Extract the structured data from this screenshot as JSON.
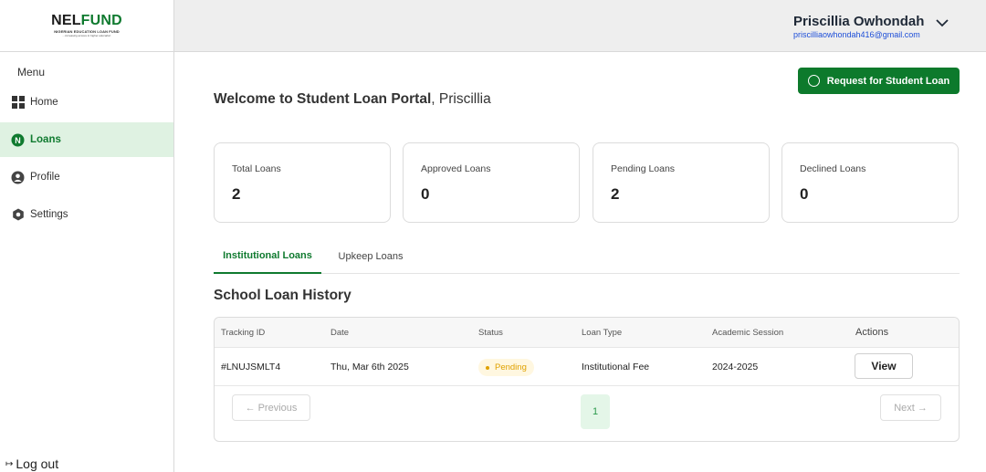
{
  "brand": {
    "logo_nel": "NEL",
    "logo_fund": "FUND",
    "logo_subtitle": "NIGERIAN EDUCATION LOAN FUND",
    "logo_tagline": "...increasing access to higher education",
    "accent_color": "#0d7a2c"
  },
  "sidebar": {
    "menu_label": "Menu",
    "items": [
      {
        "label": "Home",
        "icon": "grid-icon",
        "active": false
      },
      {
        "label": "Loans",
        "icon": "nelfund-n-icon",
        "active": true
      },
      {
        "label": "Profile",
        "icon": "user-icon",
        "active": false
      },
      {
        "label": "Settings",
        "icon": "hexagon-settings-icon",
        "active": false
      }
    ],
    "logout_label": "Log out"
  },
  "header": {
    "user_name": "Priscillia Owhondah",
    "user_email": "priscilliaowhondah416@gmail.com"
  },
  "main": {
    "request_button": "Request for Student Loan",
    "welcome_strong": "Welcome to Student Loan Portal",
    "welcome_name": ", Priscillia",
    "stats": [
      {
        "label": "Total Loans",
        "value": "2"
      },
      {
        "label": "Approved Loans",
        "value": "0"
      },
      {
        "label": "Pending Loans",
        "value": "2"
      },
      {
        "label": "Declined Loans",
        "value": "0"
      }
    ],
    "tabs": [
      {
        "label": "Institutional Loans",
        "active": true
      },
      {
        "label": "Upkeep Loans",
        "active": false
      }
    ],
    "history_title": "School Loan History",
    "table": {
      "headers": [
        "Tracking ID",
        "Date",
        "Status",
        "Loan Type",
        "Academic Session",
        "Actions"
      ],
      "rows": [
        {
          "tracking_id": "#LNUJSMLT4",
          "date": "Thu, Mar 6th 2025",
          "status": "Pending",
          "loan_type": "Institutional Fee",
          "session": "2024-2025",
          "action": "View"
        }
      ]
    },
    "pagination": {
      "previous": "Previous",
      "next": "Next",
      "current_page": "1"
    }
  }
}
